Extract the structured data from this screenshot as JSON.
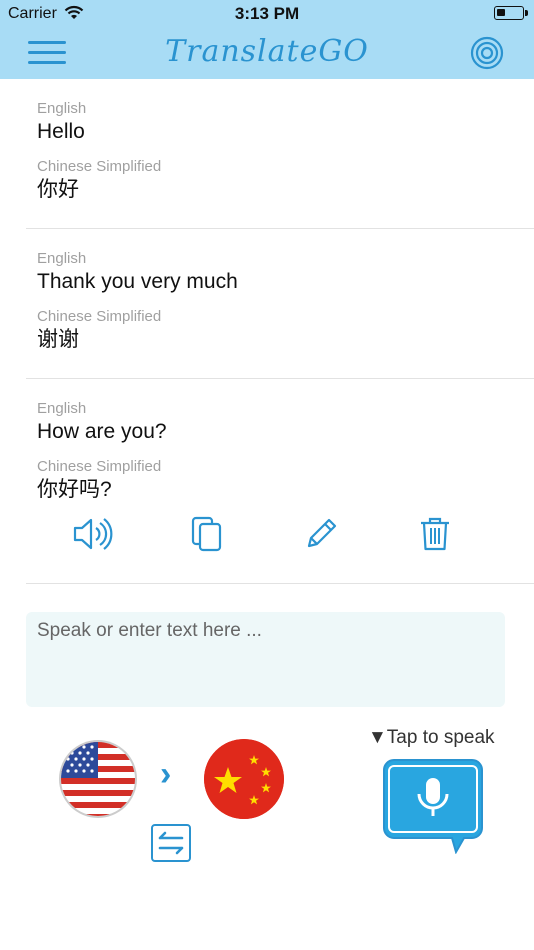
{
  "status": {
    "carrier": "Carrier",
    "time": "3:13 PM"
  },
  "header": {
    "title": "TranslateGO"
  },
  "entries": [
    {
      "source_lang": "English",
      "source_text": "Hello",
      "target_lang": "Chinese Simplified",
      "target_text": "你好"
    },
    {
      "source_lang": "English",
      "source_text": "Thank you very much",
      "target_lang": "Chinese Simplified",
      "target_text": "谢谢"
    },
    {
      "source_lang": "English",
      "source_text": "How are you?",
      "target_lang": "Chinese Simplified",
      "target_text": "你好吗?"
    }
  ],
  "input": {
    "placeholder": "Speak or enter text here ..."
  },
  "speak": {
    "hint": "▼Tap to speak"
  },
  "icons": {
    "menu": "menu-icon",
    "target": "target-icon",
    "speaker": "speaker-icon",
    "copy": "copy-icon",
    "edit": "pencil-icon",
    "delete": "trash-icon",
    "swap": "swap-icon",
    "mic": "microphone-icon"
  },
  "colors": {
    "header_bg": "#a8dcf5",
    "accent": "#2a93d0",
    "input_bg": "#eef8f9"
  }
}
